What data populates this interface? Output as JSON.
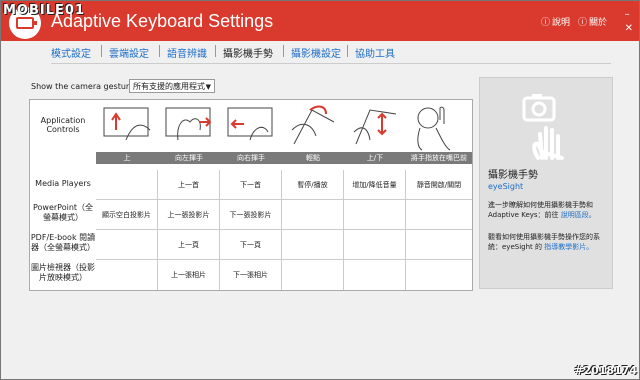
{
  "watermark": "MOBILE01",
  "app_title": "Adaptive Keyboard Settings",
  "title_links": {
    "help": "說明",
    "about": "關於"
  },
  "tabs": [
    {
      "label": "模式設定"
    },
    {
      "label": "雲端設定"
    },
    {
      "label": "語音辨識"
    },
    {
      "label": "攝影機手勢"
    },
    {
      "label": "攝影機設定"
    },
    {
      "label": "協助工具"
    }
  ],
  "filter": {
    "label": "Show the camera gesture for",
    "value": "所有支援的應用程式"
  },
  "grid": {
    "corner_label": "Application Controls",
    "gestures": [
      "上",
      "向左揮手",
      "向右揮手",
      "輕點",
      "上/下",
      "將手指放在嘴巴前"
    ],
    "rows": [
      {
        "app": "Media Players",
        "cells": [
          "",
          "上一首",
          "下一首",
          "暫停/播放",
          "增加/降低音量",
          "靜音開啟/關閉"
        ]
      },
      {
        "app": "PowerPoint（全螢幕模式）",
        "cells": [
          "顯示空白投影片",
          "上一張投影片",
          "下一張投影片",
          "",
          "",
          ""
        ]
      },
      {
        "app": "PDF/E-book 閱讀器（全螢幕模式）",
        "cells": [
          "",
          "上一頁",
          "下一頁",
          "",
          "",
          ""
        ]
      },
      {
        "app": "圖片檢視器（投影片放映模式）",
        "cells": [
          "",
          "上一張相片",
          "下一張相片",
          "",
          "",
          ""
        ]
      }
    ]
  },
  "side": {
    "title": "攝影機手勢",
    "brand": "eyeSight",
    "text1": "進一步瞭解如何使用攝影機手勢和 Adaptive Keys：前往",
    "link1": "說明區段。",
    "text2": "觀看如何使用攝影機手勢操作您的系統：eyeSight 的",
    "link2": "指導教學影片。"
  },
  "stamp": "#2018174",
  "colors": {
    "accent": "#d93a2d",
    "link": "#1e6ec8",
    "bar": "#7a7a7a"
  }
}
